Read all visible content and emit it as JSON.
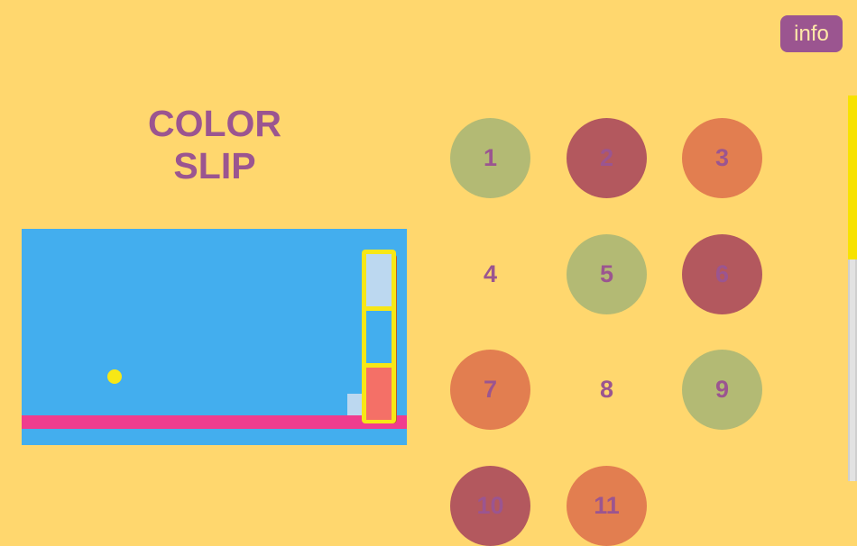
{
  "info_button": {
    "label": "info"
  },
  "title": {
    "line1": "COLOR",
    "line2": "SLIP"
  },
  "colors": {
    "background": "#ffd76e",
    "accent": "#9b5590",
    "preview_sky": "#43aeee",
    "floor": "#f03c8e",
    "ball": "#f7e716",
    "green": "#b3ba74",
    "red": "#b3585e",
    "orange": "#e27e50"
  },
  "levels": [
    {
      "number": "1",
      "color": "#b3ba74"
    },
    {
      "number": "2",
      "color": "#b3585e"
    },
    {
      "number": "3",
      "color": "#e27e50"
    },
    {
      "number": "4",
      "color": "transparent"
    },
    {
      "number": "5",
      "color": "#b3ba74"
    },
    {
      "number": "6",
      "color": "#b3585e"
    },
    {
      "number": "7",
      "color": "#e27e50"
    },
    {
      "number": "8",
      "color": "transparent"
    },
    {
      "number": "9",
      "color": "#b3ba74"
    },
    {
      "number": "10",
      "color": "#b3585e"
    },
    {
      "number": "11",
      "color": "#e27e50"
    }
  ]
}
